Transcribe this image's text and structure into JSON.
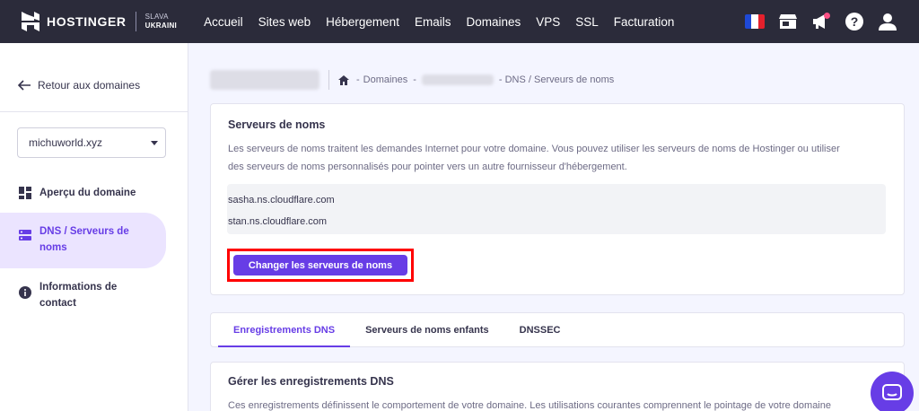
{
  "brand": {
    "name": "HOSTINGER",
    "slogan_line1": "SLAVA",
    "slogan_line2": "UKRAINI"
  },
  "nav": {
    "items": [
      "Accueil",
      "Sites web",
      "Hébergement",
      "Emails",
      "Domaines",
      "VPS",
      "SSL",
      "Facturation"
    ]
  },
  "top_icons": [
    "france-flag-icon",
    "store-icon",
    "megaphone-icon",
    "help-icon",
    "account-icon"
  ],
  "sidebar": {
    "back_label": "Retour aux domaines",
    "selected_domain": "michuworld.xyz",
    "items": [
      {
        "label": "Aperçu du domaine",
        "icon": "dashboard-icon"
      },
      {
        "label": "DNS / Serveurs de noms",
        "icon": "dns-icon"
      },
      {
        "label": "Informations de contact",
        "icon": "info-icon"
      }
    ]
  },
  "breadcrumb": {
    "home_icon": "home-icon",
    "sep1": "-",
    "domains": "Domaines",
    "sep2": "-",
    "current": "- DNS / Serveurs de noms"
  },
  "nameservers_card": {
    "title": "Serveurs de noms",
    "description_line1": "Les serveurs de noms traitent les demandes Internet pour votre domaine. Vous pouvez utiliser les serveurs de noms de Hostinger ou utiliser",
    "description_line2": "des serveurs de noms personnalisés pour pointer vers un autre fournisseur d'hébergement.",
    "nameservers": [
      "sasha.ns.cloudflare.com",
      "stan.ns.cloudflare.com"
    ],
    "button_label": "Changer les serveurs de noms"
  },
  "tabs": [
    "Enregistrements DNS",
    "Serveurs de noms enfants",
    "DNSSEC"
  ],
  "dns_card": {
    "title": "Gérer les enregistrements DNS",
    "description": "Ces enregistrements définissent le comportement de votre domaine. Les utilisations courantes comprennent le pointage de votre domaine"
  },
  "colors": {
    "accent": "#673de6",
    "topbar": "#2b2b3a",
    "highlight": "#ff0000"
  }
}
